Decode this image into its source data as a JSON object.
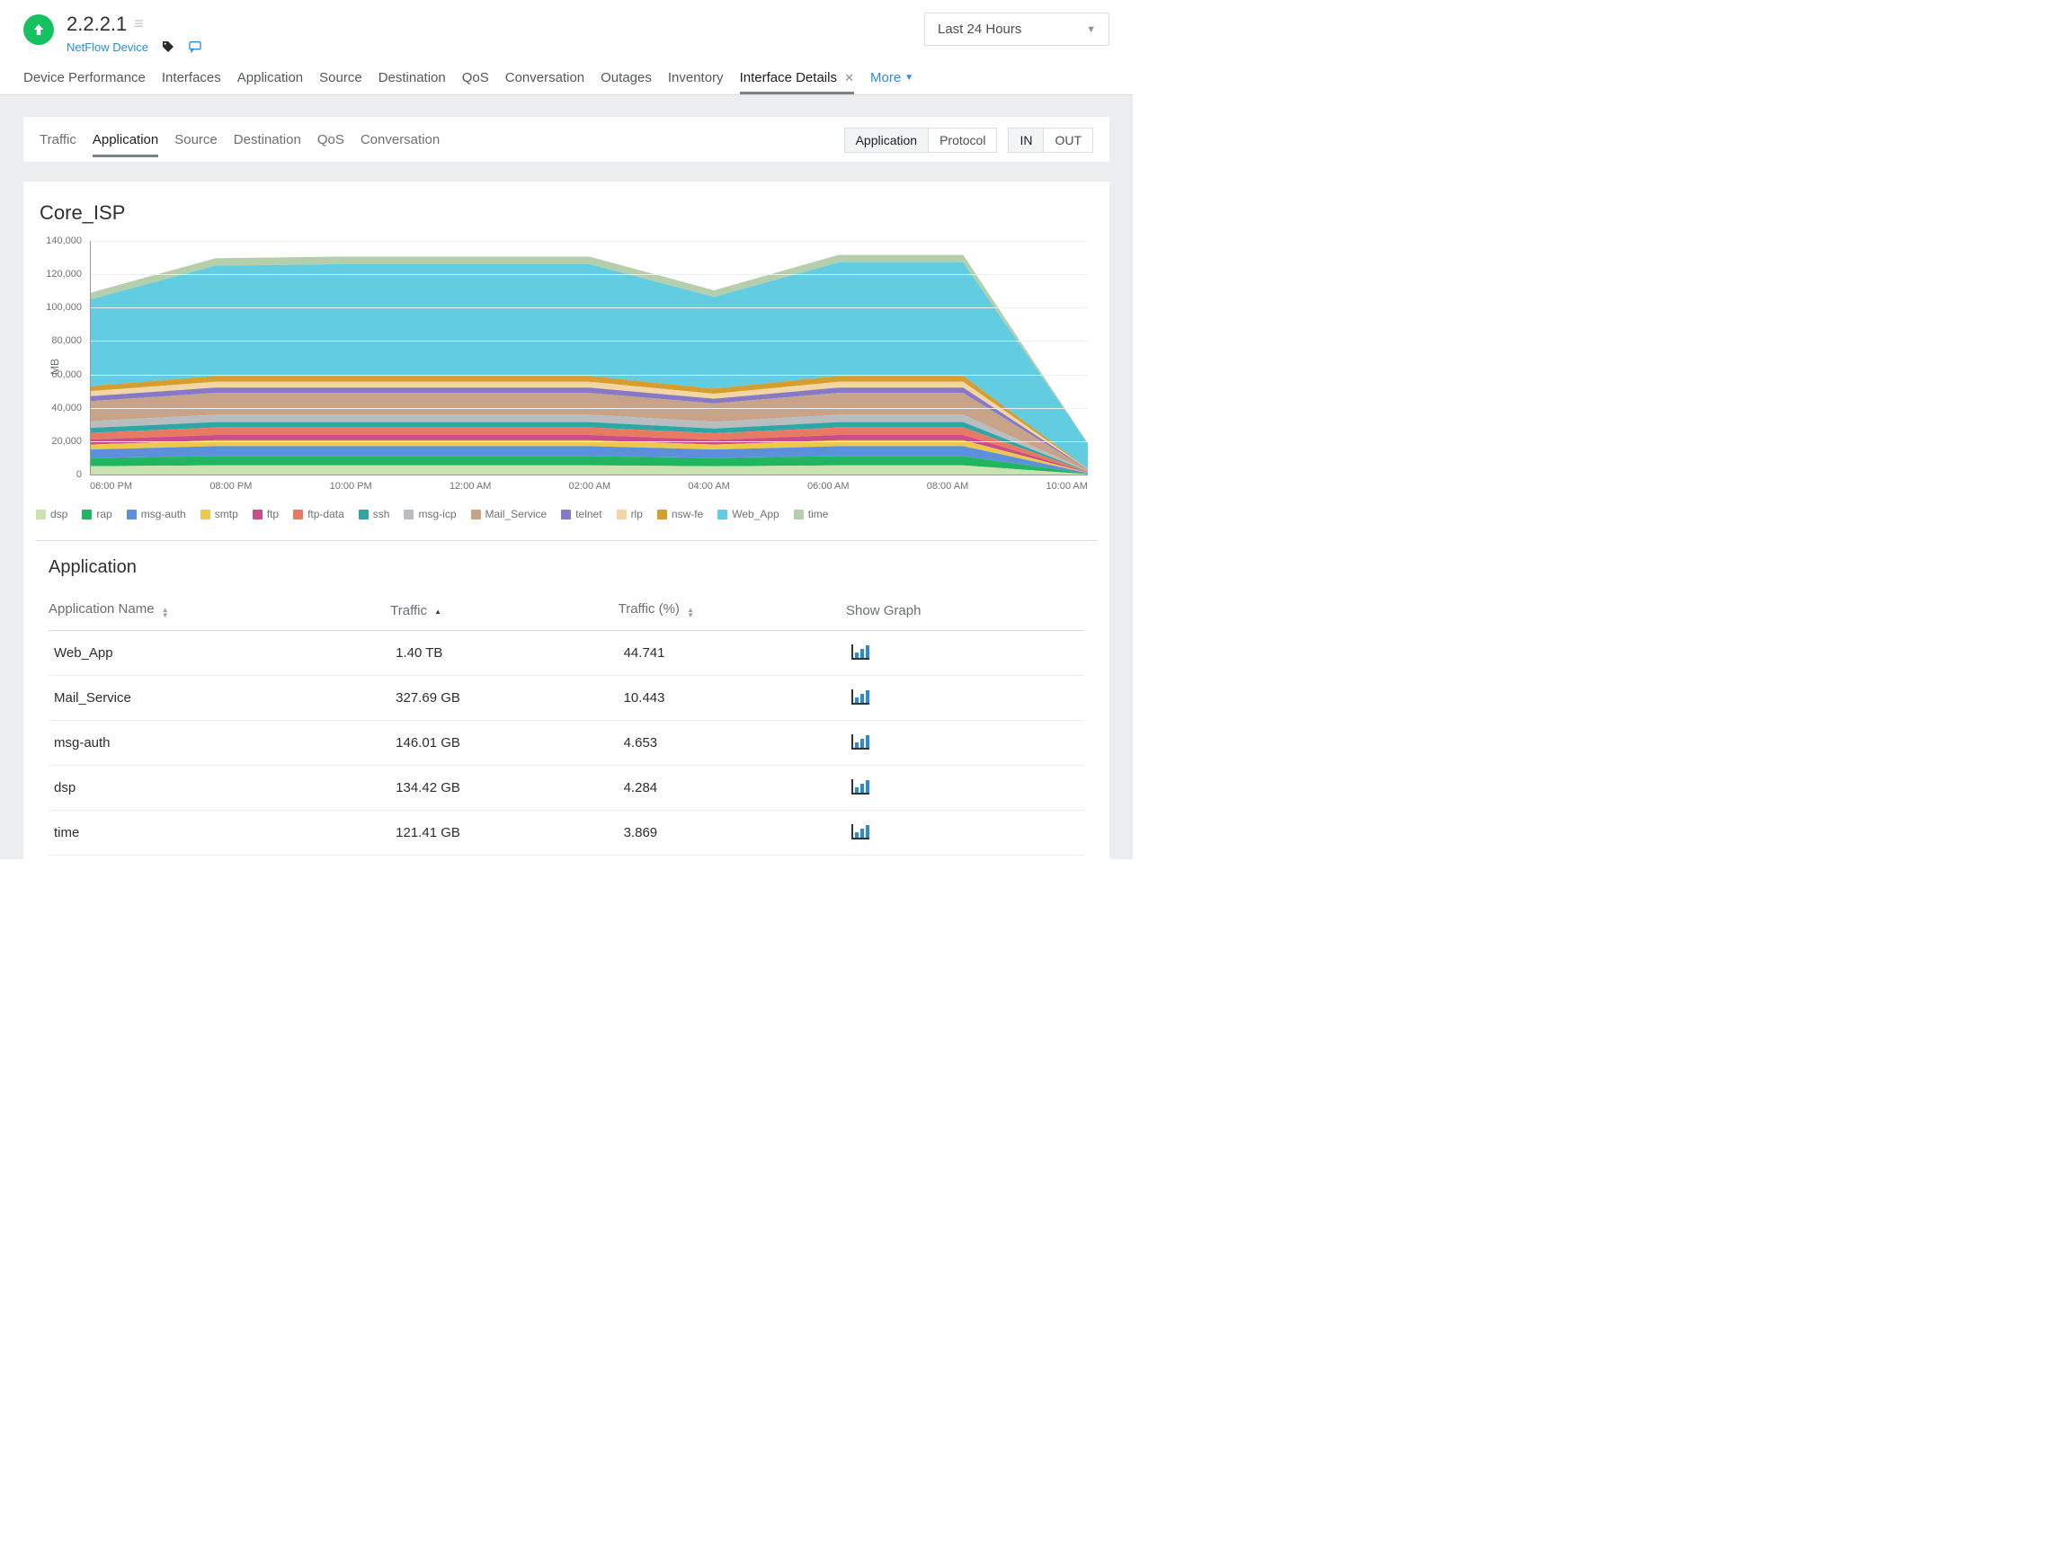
{
  "header": {
    "title": "2.2.2.1",
    "device_link": "NetFlow Device",
    "range_label": "Last 24 Hours"
  },
  "primary_tabs": {
    "items": [
      "Device Performance",
      "Interfaces",
      "Application",
      "Source",
      "Destination",
      "QoS",
      "Conversation",
      "Outages",
      "Inventory",
      "Interface Details"
    ],
    "more_label": "More"
  },
  "subtabs": {
    "items": [
      "Traffic",
      "Application",
      "Source",
      "Destination",
      "QoS",
      "Conversation"
    ],
    "active": "Application"
  },
  "view_toggle": {
    "a": "Application",
    "b": "Protocol"
  },
  "dir_toggle": {
    "a": "IN",
    "b": "OUT"
  },
  "chart_header": "Core_ISP",
  "table": {
    "title": "Application",
    "columns": {
      "c0": "Application Name",
      "c1": "Traffic",
      "c2": "Traffic (%)",
      "c3": "Show Graph"
    },
    "rows": [
      {
        "name": "Web_App",
        "traffic": "1.40 TB",
        "pct": "44.741"
      },
      {
        "name": "Mail_Service",
        "traffic": "327.69 GB",
        "pct": "10.443"
      },
      {
        "name": "msg-auth",
        "traffic": "146.01 GB",
        "pct": "4.653"
      },
      {
        "name": "dsp",
        "traffic": "134.42 GB",
        "pct": "4.284"
      },
      {
        "name": "time",
        "traffic": "121.41 GB",
        "pct": "3.869"
      }
    ]
  },
  "chart_data": {
    "type": "area",
    "title": "Core_ISP",
    "ylabel": "MB",
    "ylim": [
      0,
      140000
    ],
    "yticks": [
      0,
      20000,
      40000,
      60000,
      80000,
      100000,
      120000,
      140000
    ],
    "x": [
      "06:00 PM",
      "08:00 PM",
      "10:00 PM",
      "12:00 AM",
      "02:00 AM",
      "04:00 AM",
      "06:00 AM",
      "08:00 AM",
      "10:00 AM"
    ],
    "series": [
      {
        "name": "dsp",
        "color": "#c9e2b0",
        "values": [
          5000,
          5500,
          5500,
          5500,
          5500,
          5000,
          5500,
          5500,
          200
        ]
      },
      {
        "name": "rap",
        "color": "#22b561",
        "values": [
          5000,
          5500,
          5500,
          5500,
          5500,
          5000,
          5500,
          5500,
          300
        ]
      },
      {
        "name": "msg-auth",
        "color": "#5c8fdc",
        "values": [
          5000,
          6000,
          6000,
          6000,
          6000,
          5000,
          6000,
          6000,
          400
        ]
      },
      {
        "name": "smtp",
        "color": "#ecc94b",
        "values": [
          3000,
          3500,
          3500,
          3500,
          3500,
          3000,
          3500,
          3500,
          200
        ]
      },
      {
        "name": "ftp",
        "color": "#c94d88",
        "values": [
          3000,
          3200,
          3200,
          3200,
          3200,
          2800,
          3200,
          3200,
          200
        ]
      },
      {
        "name": "ftp-data",
        "color": "#e87a63",
        "values": [
          4000,
          4500,
          4500,
          4500,
          4500,
          4000,
          4500,
          4500,
          300
        ]
      },
      {
        "name": "ssh",
        "color": "#2fa6a6",
        "values": [
          3000,
          3200,
          3200,
          3200,
          3200,
          2800,
          3200,
          3200,
          200
        ]
      },
      {
        "name": "msg-icp",
        "color": "#b9bdc0",
        "values": [
          4000,
          4500,
          4500,
          4500,
          4500,
          4000,
          4500,
          4500,
          300
        ]
      },
      {
        "name": "Mail_Service",
        "color": "#c7a38a",
        "values": [
          12000,
          13000,
          13000,
          13000,
          13000,
          11000,
          13000,
          13000,
          700
        ]
      },
      {
        "name": "telnet",
        "color": "#8679c6",
        "values": [
          3000,
          3200,
          3200,
          3200,
          3200,
          2800,
          3200,
          3200,
          300
        ]
      },
      {
        "name": "rlp",
        "color": "#f3d6a4",
        "values": [
          3000,
          3500,
          3500,
          3500,
          3500,
          3000,
          3500,
          3500,
          200
        ]
      },
      {
        "name": "nsw-fe",
        "color": "#d69e2e",
        "values": [
          3000,
          3500,
          3500,
          3500,
          3500,
          3000,
          3500,
          3500,
          200
        ]
      },
      {
        "name": "Web_App",
        "color": "#62cce0",
        "values": [
          52000,
          66000,
          67000,
          67000,
          67000,
          55000,
          68000,
          68000,
          15000
        ]
      },
      {
        "name": "time",
        "color": "#b5ceab",
        "values": [
          4000,
          4500,
          4500,
          4500,
          4500,
          4000,
          4500,
          4500,
          300
        ]
      }
    ]
  }
}
